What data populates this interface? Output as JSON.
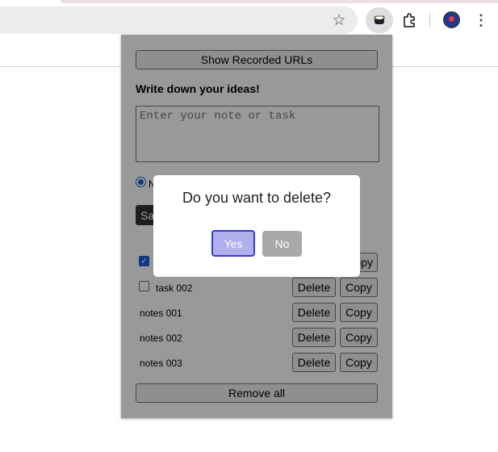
{
  "browser": {
    "toolbar_icons": [
      "star-icon",
      "extension-icon",
      "puzzle-icon",
      "profile-avatar",
      "menu-icon"
    ]
  },
  "popup": {
    "show_urls_label": "Show Recorded URLs",
    "heading": "Write down your ideas!",
    "note_placeholder": "Enter your note or task",
    "radio_label_visible": "N",
    "save_label_visible": "Sa",
    "items": [
      {
        "label": "",
        "checked": true,
        "has_checkbox": true
      },
      {
        "label": "task 002",
        "checked": false,
        "has_checkbox": true
      },
      {
        "label": "notes 001",
        "has_checkbox": false
      },
      {
        "label": "notes 002",
        "has_checkbox": false
      },
      {
        "label": "notes 003",
        "has_checkbox": false
      }
    ],
    "delete_label": "Delete",
    "copy_label": "Copy",
    "copy_label_partial": "opy",
    "remove_all_label": "Remove all"
  },
  "dialog": {
    "message": "Do you want to delete?",
    "yes_label": "Yes",
    "no_label": "No"
  },
  "colors": {
    "yes_bg": "#afafee",
    "yes_border": "#3a3ad0",
    "no_bg": "#a9a9a9",
    "overlay": "rgba(0,0,0,0.4)"
  }
}
